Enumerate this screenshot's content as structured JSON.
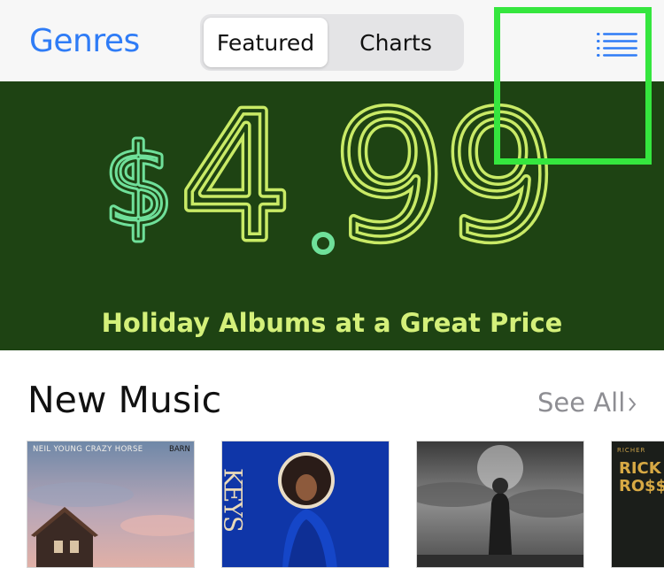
{
  "navbar": {
    "genres_label": "Genres",
    "tabs": [
      {
        "label": "Featured",
        "selected": true
      },
      {
        "label": "Charts",
        "selected": false
      }
    ],
    "menu_icon": "list-icon"
  },
  "banner": {
    "currency": "$",
    "price_whole": "4",
    "price_decimal": ".",
    "price_cents": "99",
    "caption": "Holiday Albums at a Great Price",
    "colors": {
      "background": "#1e4313",
      "accent": "#d4f07a",
      "mint": "#6fe09a"
    }
  },
  "new_music": {
    "title": "New Music",
    "see_all": "See All",
    "albums": [
      {
        "cover_text": "NEIL YOUNG CRAZY HORSE",
        "cover_text_accent": "BARN"
      },
      {
        "cover_text": "KEYS"
      },
      {
        "cover_text": ""
      },
      {
        "cover_text_top": "RICHER",
        "cover_text": "RICK RO$$"
      }
    ]
  },
  "colors": {
    "link": "#2f7cf6",
    "highlight": "#35e63e"
  }
}
